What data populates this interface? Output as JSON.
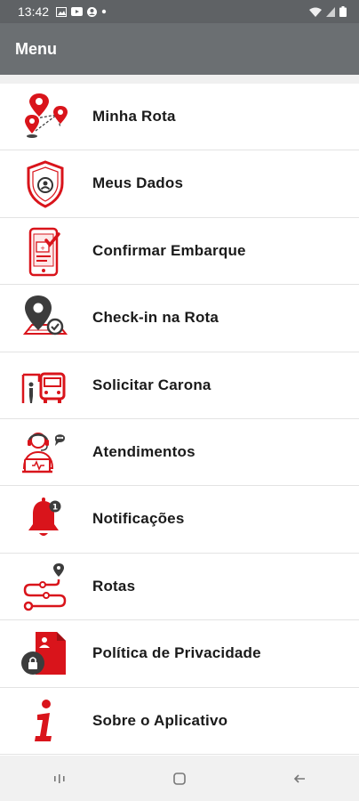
{
  "status_bar": {
    "time": "13:42"
  },
  "app_bar": {
    "title": "Menu"
  },
  "menu": {
    "items": [
      {
        "label": "Minha Rota",
        "icon": "route-map-icon"
      },
      {
        "label": "Meus Dados",
        "icon": "shield-user-icon"
      },
      {
        "label": "Confirmar Embarque",
        "icon": "phone-check-icon"
      },
      {
        "label": "Check-in na Rota",
        "icon": "map-pin-check-icon"
      },
      {
        "label": "Solicitar Carona",
        "icon": "bus-stop-icon"
      },
      {
        "label": "Atendimentos",
        "icon": "support-agent-icon"
      },
      {
        "label": "Notificações",
        "icon": "bell-icon"
      },
      {
        "label": "Rotas",
        "icon": "route-path-icon"
      },
      {
        "label": "Política de Privacidade",
        "icon": "privacy-document-icon"
      },
      {
        "label": "Sobre o Aplicativo",
        "icon": "info-icon"
      }
    ]
  },
  "colors": {
    "accent": "#d9141b",
    "dark": "#3c3c3c",
    "appbar": "#6b6f72",
    "statusbar": "#5f6265"
  }
}
